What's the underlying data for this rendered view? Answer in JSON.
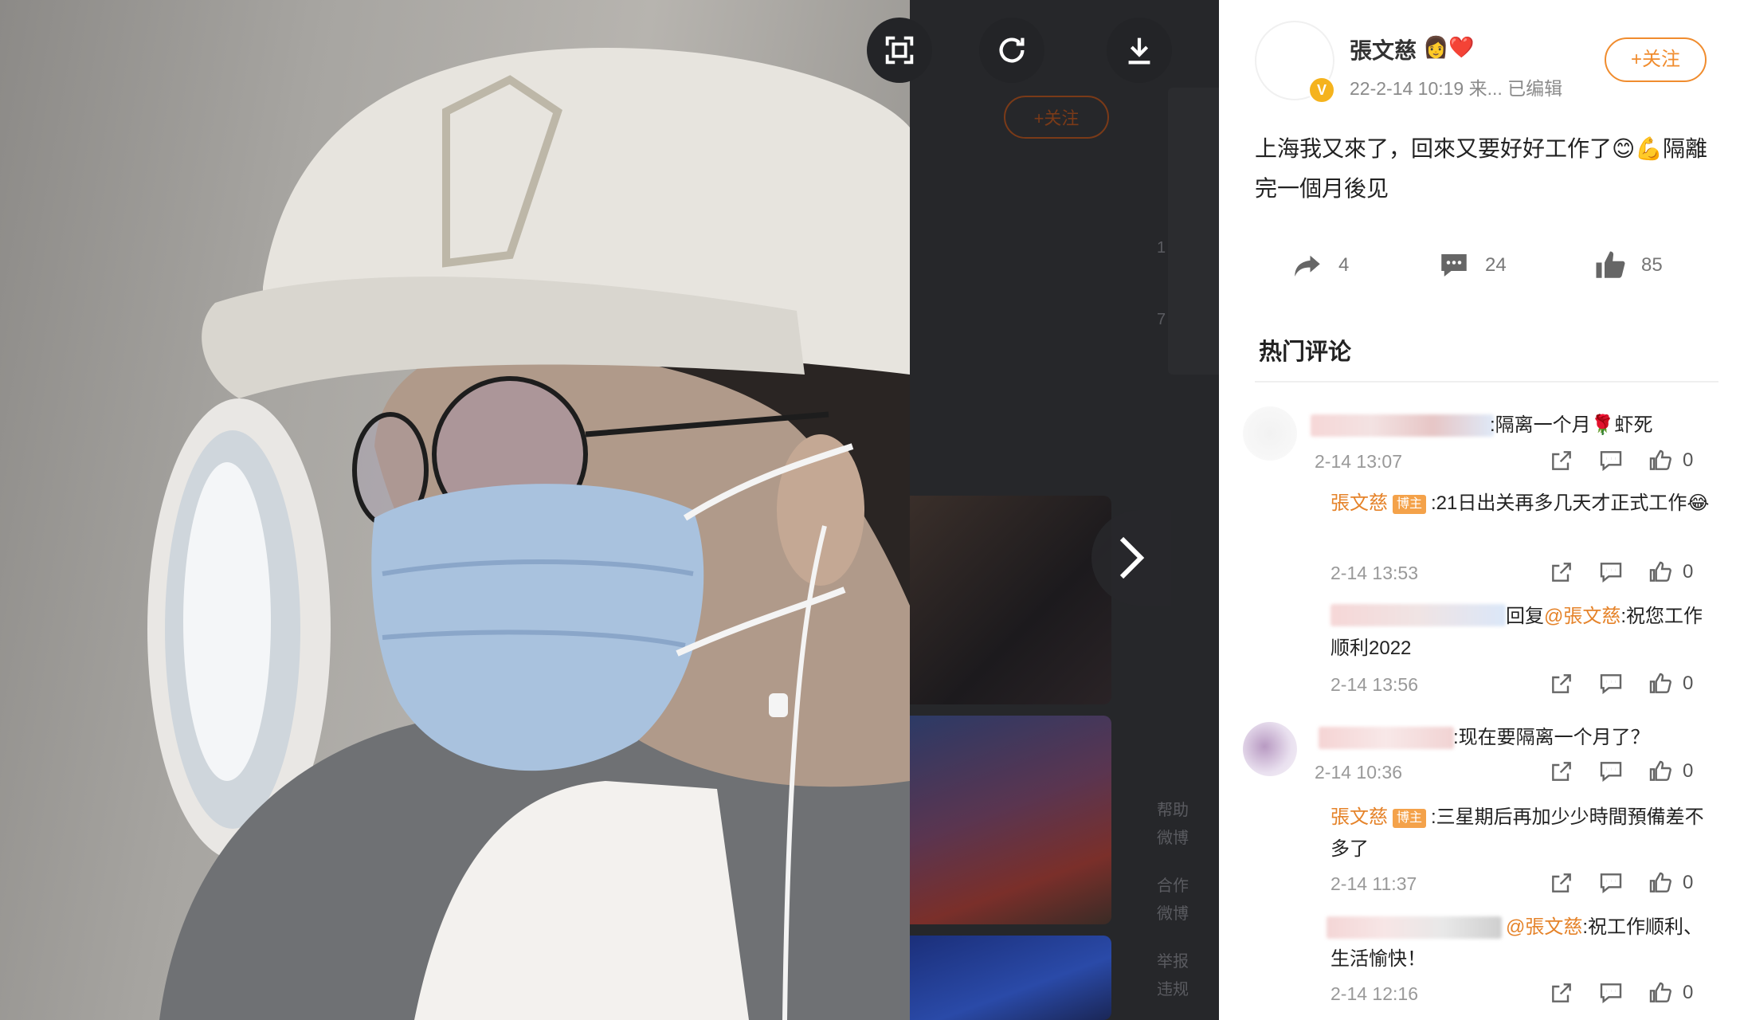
{
  "viewer": {
    "ghost_follow_label": "+关注",
    "ghost_side_text": [
      "1",
      "7",
      "帮助",
      "微博",
      "合作",
      "微博",
      "举报",
      "违规"
    ]
  },
  "post": {
    "author": "張文慈",
    "author_emoji": "👩‍❤️",
    "verified_badge": "V",
    "meta": "22-2-14 10:19  来...  已编辑",
    "follow_label": "+关注",
    "text": "上海我又來了，回來又要好好工作了😊💪隔離完一個月後见",
    "repost_count": "4",
    "comment_count": "24",
    "like_count": "85"
  },
  "hot_comments": {
    "title": "热门评论",
    "items": [
      {
        "text": ":隔离一个月🌹虾死",
        "time": "2-14 13:07",
        "likes": "0",
        "replies": [
          {
            "user": "張文慈",
            "tag": "博主",
            "text": ":21日出关再多几天才正式工作😂",
            "time": "2-14 13:53",
            "likes": "0"
          },
          {
            "prefix": "回复",
            "mention": "@張文慈",
            "text": ":祝您工作顺利2022",
            "time": "2-14 13:56",
            "likes": "0"
          }
        ]
      },
      {
        "text": ":现在要隔离一个月了？",
        "time": "2-14 10:36",
        "likes": "0",
        "replies": [
          {
            "user": "張文慈",
            "tag": "博主",
            "text": ":三星期后再加少少時間預備差不多了",
            "time": "2-14 11:37",
            "likes": "0"
          },
          {
            "mention": "@張文慈",
            "text": ":祝工作顺利、生活愉快！",
            "time": "2-14 12:16",
            "likes": "0"
          }
        ]
      }
    ]
  },
  "colors": {
    "accent": "#f08c2e",
    "username": "#e5832a",
    "host_tag": "#f4a24a",
    "viewer_bg": "#1f2023"
  }
}
